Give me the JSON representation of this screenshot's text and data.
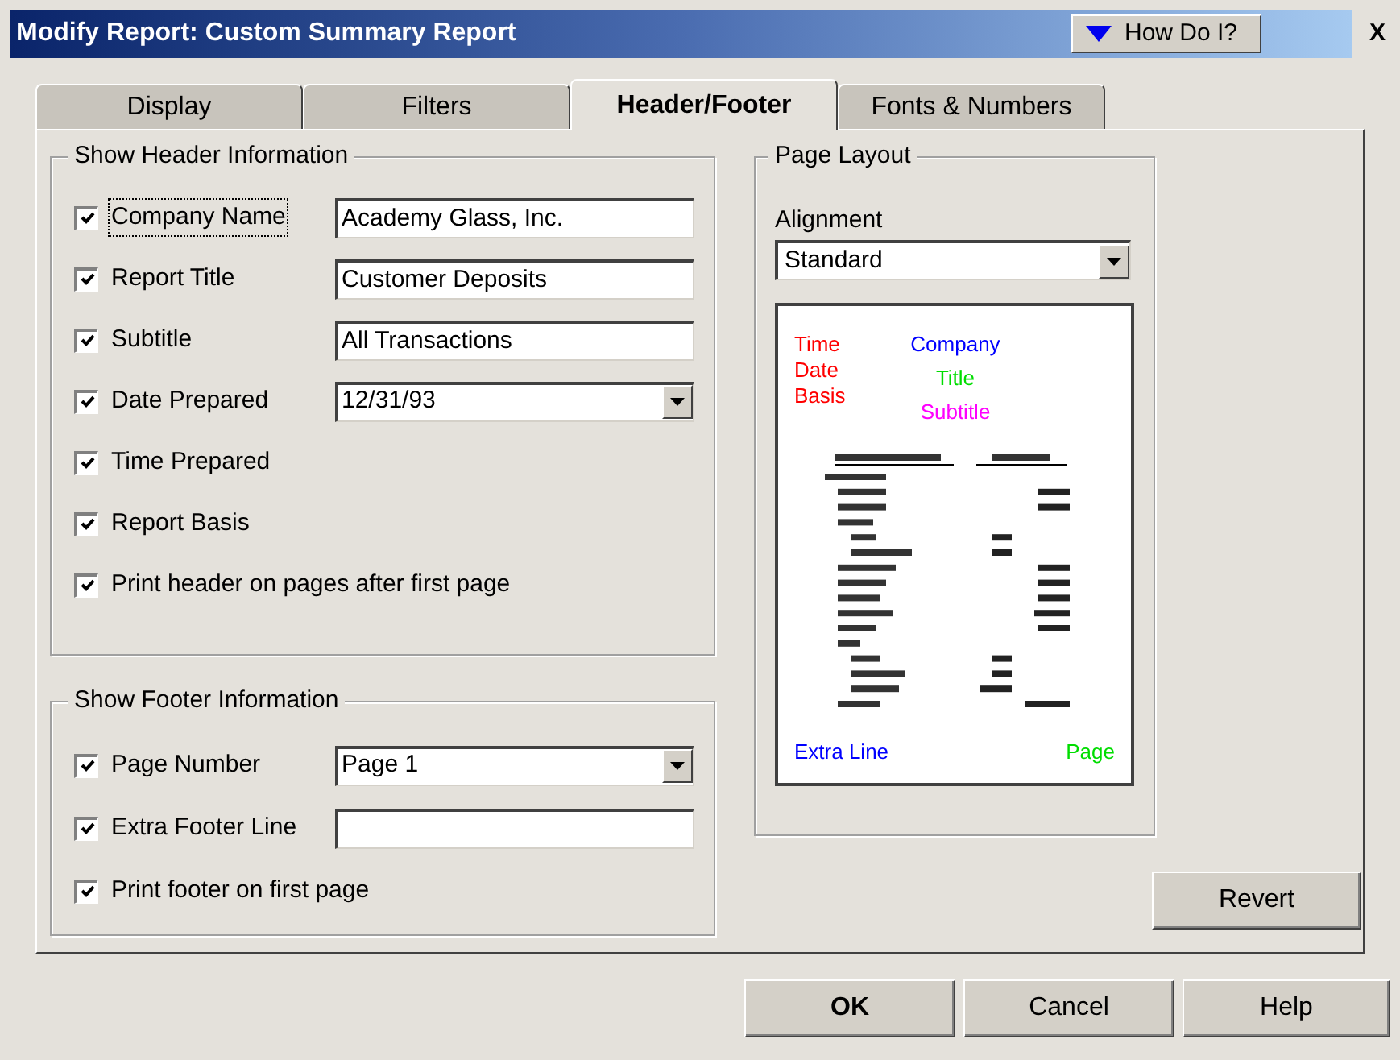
{
  "window": {
    "title": "Modify Report: Custom Summary Report",
    "help_button": "How Do I?",
    "close": "X"
  },
  "tabs": [
    {
      "label": "Display",
      "selected": false
    },
    {
      "label": "Filters",
      "selected": false
    },
    {
      "label": "Header/Footer",
      "selected": true
    },
    {
      "label": "Fonts & Numbers",
      "selected": false
    }
  ],
  "header_group": {
    "title": "Show Header Information",
    "rows": [
      {
        "kind": "text",
        "label": "Company Name",
        "checked": true,
        "value": "Academy Glass, Inc.",
        "focused": true
      },
      {
        "kind": "text",
        "label": "Report Title",
        "checked": true,
        "value": "Customer Deposits",
        "focused": false
      },
      {
        "kind": "text",
        "label": "Subtitle",
        "checked": true,
        "value": "All Transactions",
        "focused": false
      },
      {
        "kind": "dropdown",
        "label": "Date Prepared",
        "checked": true,
        "value": "12/31/93",
        "focused": false
      },
      {
        "kind": "check",
        "label": "Time Prepared",
        "checked": true,
        "focused": false
      },
      {
        "kind": "check",
        "label": "Report Basis",
        "checked": true,
        "focused": false
      },
      {
        "kind": "check",
        "label": "Print header on pages after first page",
        "checked": true,
        "focused": false
      }
    ]
  },
  "footer_group": {
    "title": "Show Footer Information",
    "rows": [
      {
        "kind": "dropdown",
        "label": "Page Number",
        "checked": true,
        "value": "Page 1",
        "focused": false
      },
      {
        "kind": "text",
        "label": "Extra Footer Line",
        "checked": true,
        "value": "",
        "focused": false
      },
      {
        "kind": "check",
        "label": "Print footer on first page",
        "checked": true,
        "focused": false
      }
    ]
  },
  "page_layout": {
    "title": "Page Layout",
    "alignment_label": "Alignment",
    "alignment": "Standard",
    "preview": {
      "left_header": [
        {
          "text": "Time",
          "color": "#ff0000"
        },
        {
          "text": "Date",
          "color": "#ff0000"
        },
        {
          "text": "Basis",
          "color": "#ff0000"
        }
      ],
      "center_header": [
        {
          "text": "Company",
          "color": "#0000ff"
        },
        {
          "text": "Title",
          "color": "#00dd00"
        },
        {
          "text": "Subtitle",
          "color": "#ff00ff"
        }
      ],
      "footer_left": {
        "text": "Extra Line",
        "color": "#0000ff"
      },
      "footer_right": {
        "text": "Page",
        "color": "#00dd00"
      }
    }
  },
  "buttons": {
    "revert": "Revert",
    "ok": "OK",
    "cancel": "Cancel",
    "help": "Help"
  }
}
